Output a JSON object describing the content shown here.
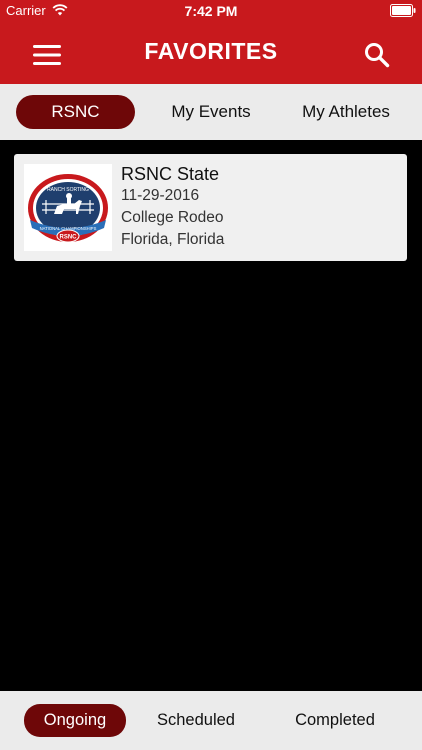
{
  "status_bar": {
    "carrier": "Carrier",
    "time": "7:42 PM"
  },
  "header": {
    "title": "FAVORITES",
    "menu_icon": "hamburger-menu-icon",
    "search_icon": "search-icon"
  },
  "tabs": [
    {
      "label": "RSNC",
      "active": true
    },
    {
      "label": "My Events",
      "active": false
    },
    {
      "label": "My Athletes",
      "active": false
    }
  ],
  "events": [
    {
      "title": "RSNC State",
      "date": "11-29-2016",
      "category": "College Rodeo",
      "location": "Florida, Florida",
      "logo": {
        "top_text": "RANCH SORTING",
        "ribbon_text": "NATIONAL CHAMPIONSHIPS",
        "badge_text": "RSNC",
        "colors": {
          "navy": "#1f3f6e",
          "red": "#c8191d",
          "blue": "#2a6fb8"
        }
      }
    }
  ],
  "bottom_tabs": [
    {
      "label": "Ongoing",
      "active": true
    },
    {
      "label": "Scheduled",
      "active": false
    },
    {
      "label": "Completed",
      "active": false
    }
  ],
  "colors": {
    "header_red": "#c8191d",
    "active_maroon": "#6e0708",
    "tab_bar_gray": "#ebebeb",
    "background": "#000000"
  }
}
